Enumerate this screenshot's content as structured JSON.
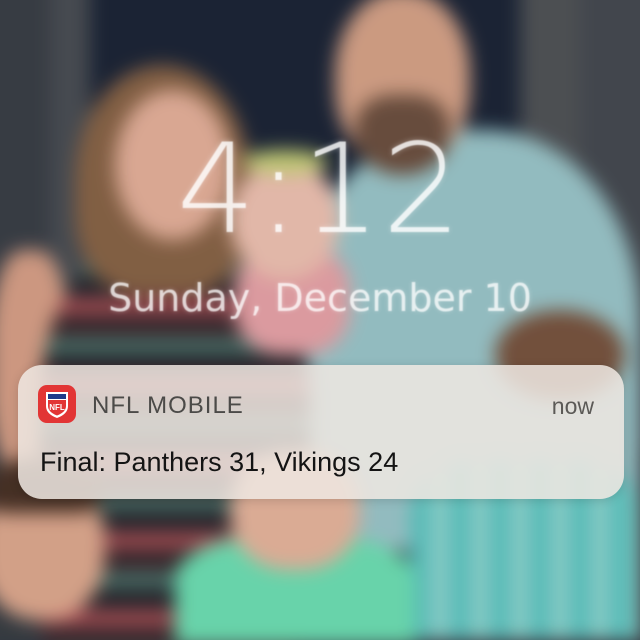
{
  "lock_screen": {
    "time": "4:12",
    "date": "Sunday, December 10"
  },
  "notification": {
    "app_name": "NFL MOBILE",
    "time_ago": "now",
    "message": "Final: Panthers 31, Vikings 24",
    "app_icon": "nfl-shield-icon",
    "app_icon_color": "#e23535"
  }
}
